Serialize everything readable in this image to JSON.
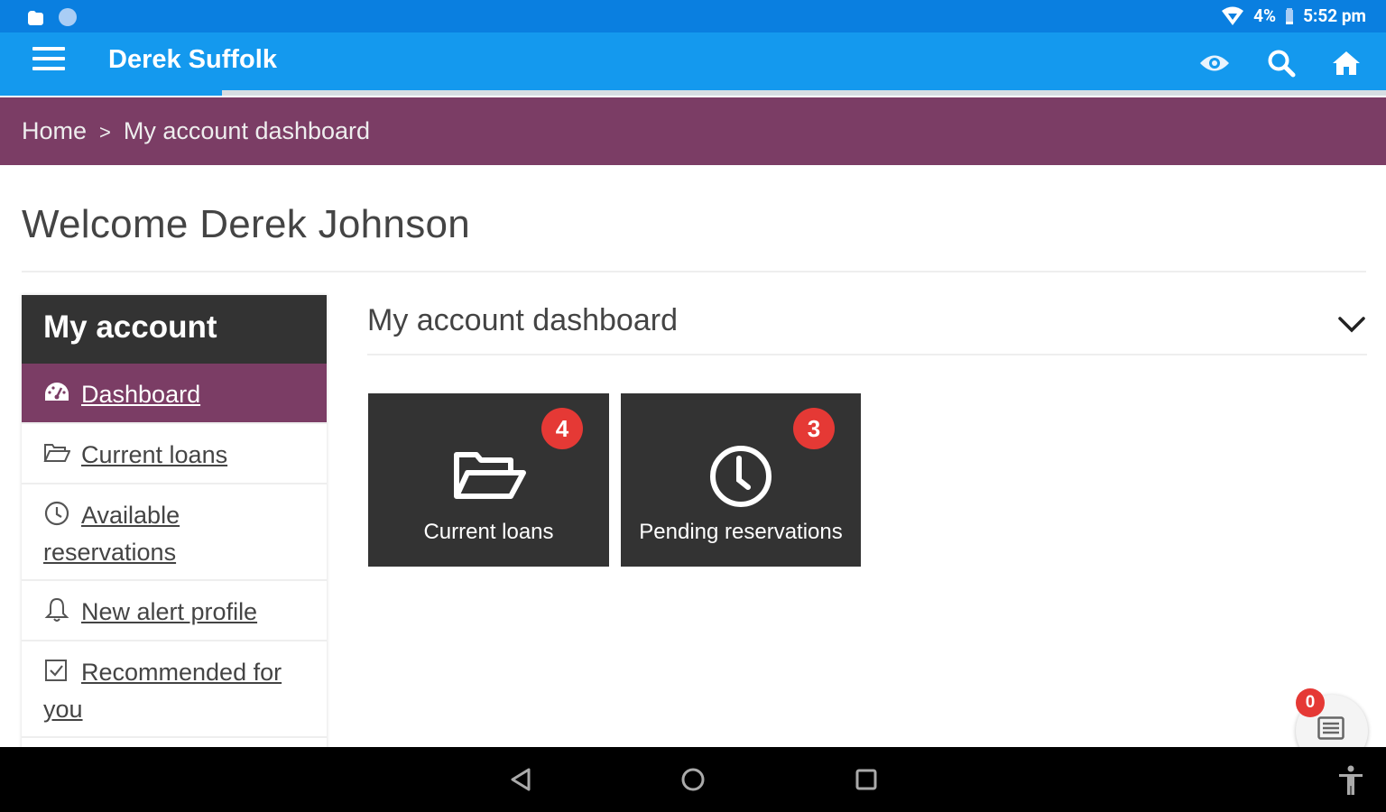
{
  "status_bar": {
    "battery": "4%",
    "time": "5:52 pm"
  },
  "app_bar": {
    "title": "Derek Suffolk",
    "progress": 0.16
  },
  "breadcrumb": {
    "home": "Home",
    "separator": ">",
    "current": "My account dashboard"
  },
  "welcome": "Welcome Derek Johnson",
  "sidebar": {
    "header": "My account",
    "items": [
      {
        "label": "Dashboard",
        "icon": "dashboard-icon"
      },
      {
        "label": "Current loans",
        "icon": "folder-open-icon"
      },
      {
        "label": "Available reservations",
        "icon": "clock-icon"
      },
      {
        "label": "New alert profile",
        "icon": "bell-icon"
      },
      {
        "label": "Recommended for you",
        "icon": "check-square-icon"
      }
    ]
  },
  "panel": {
    "title": "My account dashboard",
    "tiles": [
      {
        "label": "Current loans",
        "badge": "4",
        "icon": "folder-open-icon"
      },
      {
        "label": "Pending reservations",
        "badge": "3",
        "icon": "clock-icon"
      }
    ]
  },
  "fab": {
    "badge": "0",
    "icon": "list-icon"
  },
  "colors": {
    "status_bar": "#0a7fe0",
    "app_bar": "#1499ee",
    "accent_purple": "#7b3d65",
    "tile_bg": "#333333",
    "badge_red": "#e53935"
  }
}
